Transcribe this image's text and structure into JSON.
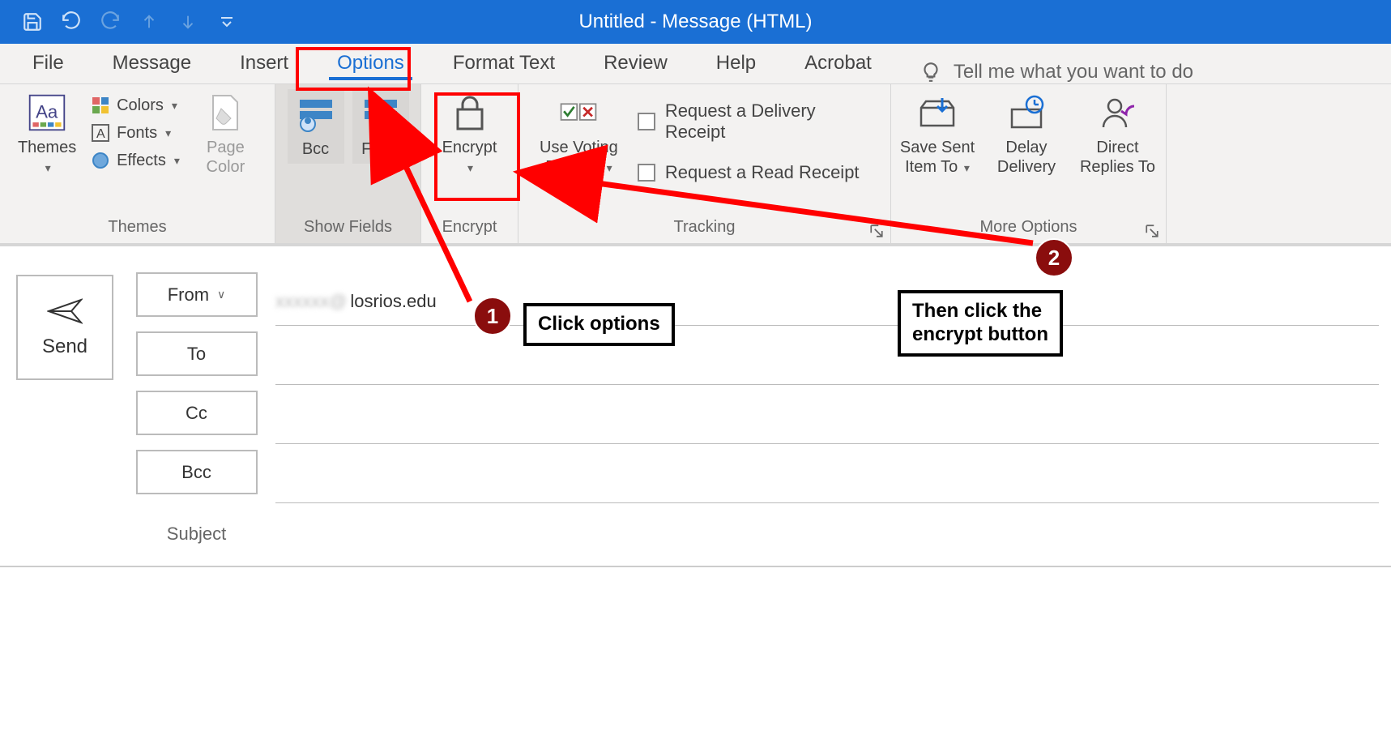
{
  "window_title": "Untitled  -  Message (HTML)",
  "tabs": {
    "file": "File",
    "message": "Message",
    "insert": "Insert",
    "options": "Options",
    "format_text": "Format Text",
    "review": "Review",
    "help": "Help",
    "acrobat": "Acrobat",
    "tell_me": "Tell me what you want to do"
  },
  "ribbon": {
    "themes": {
      "themes_btn": "Themes",
      "colors": "Colors",
      "fonts": "Fonts",
      "effects": "Effects",
      "page_color": "Page\nColor",
      "group_label": "Themes"
    },
    "show_fields": {
      "bcc": "Bcc",
      "from": "From",
      "group_label": "Show Fields"
    },
    "encrypt": {
      "encrypt": "Encrypt",
      "group_label": "Encrypt"
    },
    "tracking": {
      "voting": "Use Voting\nButtons",
      "delivery_receipt": "Request a Delivery Receipt",
      "read_receipt": "Request a Read Receipt",
      "group_label": "Tracking"
    },
    "more_options": {
      "save_sent": "Save Sent\nItem To",
      "delay": "Delay\nDelivery",
      "direct_replies": "Direct\nReplies To",
      "group_label": "More Options"
    }
  },
  "compose": {
    "send": "Send",
    "from_btn": "From",
    "to_btn": "To",
    "cc_btn": "Cc",
    "bcc_btn": "Bcc",
    "subject": "Subject",
    "from_value_suffix": "losrios.edu"
  },
  "annotations": {
    "step1_num": "1",
    "step1_text": "Click options",
    "step2_num": "2",
    "step2_text": "Then click the\nencrypt button"
  }
}
